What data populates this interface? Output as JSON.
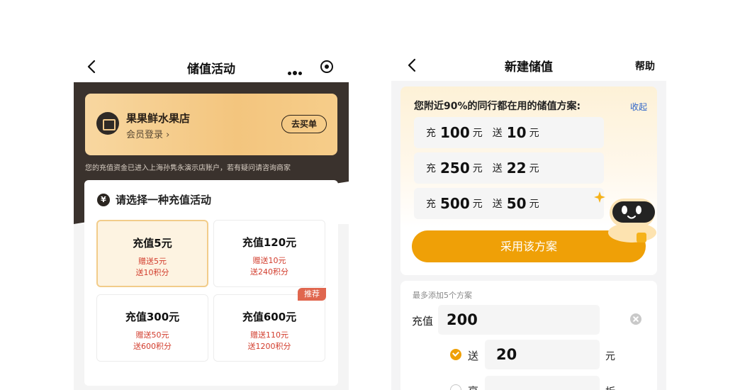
{
  "left_screen": {
    "nav": {
      "title": "储值活动"
    },
    "shop": {
      "name": "果果鲜水果店",
      "login": "会员登录 ›",
      "buy_button": "去买单"
    },
    "notice": "您的充值资金已进入上海孙隽永演示店账户，若有疑问请咨询商家",
    "section_title": "请选择一种充值活动",
    "yen_symbol": "¥",
    "options": [
      {
        "name": "充值5元",
        "bonus": "赠送5元",
        "points": "送10积分"
      },
      {
        "name": "充值120元",
        "bonus": "赠送10元",
        "points": "送240积分"
      },
      {
        "name": "充值300元",
        "bonus": "赠送50元",
        "points": "送600积分"
      },
      {
        "name": "充值600元",
        "bonus": "赠送110元",
        "points": "送1200积分",
        "badge": "推荐"
      }
    ]
  },
  "right_screen": {
    "nav": {
      "title": "新建储值",
      "help": "帮助"
    },
    "plan": {
      "title": "您附近90%的同行都在用的储值方案:",
      "collapse": "收起",
      "recharge_word": "充",
      "gift_word": "送",
      "unit": "元",
      "rows": [
        {
          "recharge": "100",
          "gift": "10"
        },
        {
          "recharge": "250",
          "gift": "22"
        },
        {
          "recharge": "500",
          "gift": "50"
        }
      ],
      "adopt_button": "采用该方案"
    },
    "form": {
      "hint": "最多添加5个方案",
      "recharge_label": "充值",
      "recharge_value": "200",
      "gift_label": "送",
      "gift_value": "20",
      "gift_unit": "元",
      "discount_label": "享",
      "discount_unit": "折"
    }
  },
  "colors": {
    "accent": "#efa007",
    "dark": "#3a322d",
    "gold": "#f3c57e",
    "red": "#d23c2c",
    "link": "#2e64c8"
  }
}
